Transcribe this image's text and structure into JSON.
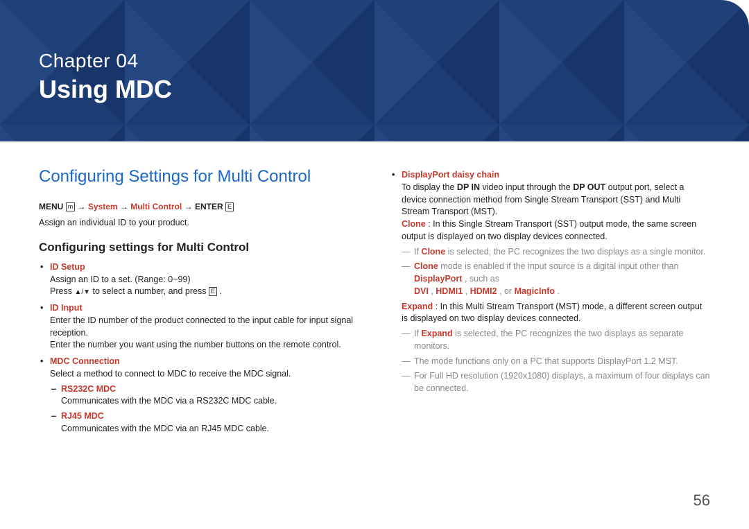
{
  "hero": {
    "chapter": "Chapter  04",
    "title": "Using MDC"
  },
  "page_number": "56",
  "left": {
    "section_heading": "Configuring Settings for Multi Control",
    "nav": {
      "menu": "MENU",
      "menu_icon": "m",
      "arrow1": " → ",
      "system": "System",
      "arrow2": " → ",
      "multicontrol": "Multi Control",
      "arrow3": " → ",
      "enter": "ENTER",
      "enter_icon": "E"
    },
    "assign_text": "Assign an individual ID to your product.",
    "sub_heading": "Configuring settings for Multi Control",
    "id_setup": {
      "label": "ID Setup",
      "line1": "Assign an ID to a set. (Range: 0~99)",
      "line2a": "Press ",
      "line2b": " to select a number, and press ",
      "line2c": "."
    },
    "id_input": {
      "label": "ID Input",
      "line1": "Enter the ID number of the product connected to the input cable for input signal reception.",
      "line2": "Enter the number you want using the number buttons on the remote control."
    },
    "mdc_conn": {
      "label": "MDC Connection",
      "line": "Select a method to connect to MDC to receive the MDC signal.",
      "rs232c_label": "RS232C MDC",
      "rs232c_text": "Communicates with the MDC via a RS232C MDC cable.",
      "rj45_label": "RJ45 MDC",
      "rj45_text": "Communicates with the MDC via an RJ45 MDC cable."
    }
  },
  "right": {
    "dp": {
      "label": "DisplayPort daisy chain",
      "intro_a": "To display the ",
      "dpin": "DP IN",
      "intro_b": " video input through the ",
      "dpout": "DP OUT",
      "intro_c": " output port, select a device connection method from Single Stream Transport (SST) and Multi Stream Transport (MST).",
      "clone_label": "Clone",
      "clone_text": ": In this Single Stream Transport (SST) output mode, the same screen output is displayed on two display devices connected.",
      "clone_note1_a": "If ",
      "clone_note1_b": " is selected, the PC recognizes the two displays as a single monitor.",
      "clone_note2_a": " mode is enabled if the input source is a digital input other than ",
      "displayport": "DisplayPort",
      "clone_note2_b": ", such as ",
      "dvi": "DVI",
      "comma1": ", ",
      "hdmi1": "HDMI1",
      "comma2": ", ",
      "hdmi2": "HDMI2",
      "or": ", or ",
      "magicinfo": "MagicInfo",
      "period": ".",
      "expand_label": "Expand",
      "expand_text": ": In this Multi Stream Transport (MST) mode, a different screen output is displayed on two display devices connected.",
      "expand_note1_a": "If ",
      "expand_note1_b": " is selected, the PC recognizes the two displays as separate monitors.",
      "expand_note2": "The mode functions only on a PC that supports DisplayPort 1.2 MST.",
      "expand_note3": "For Full HD resolution (1920x1080) displays, a maximum of four displays can be connected."
    }
  }
}
